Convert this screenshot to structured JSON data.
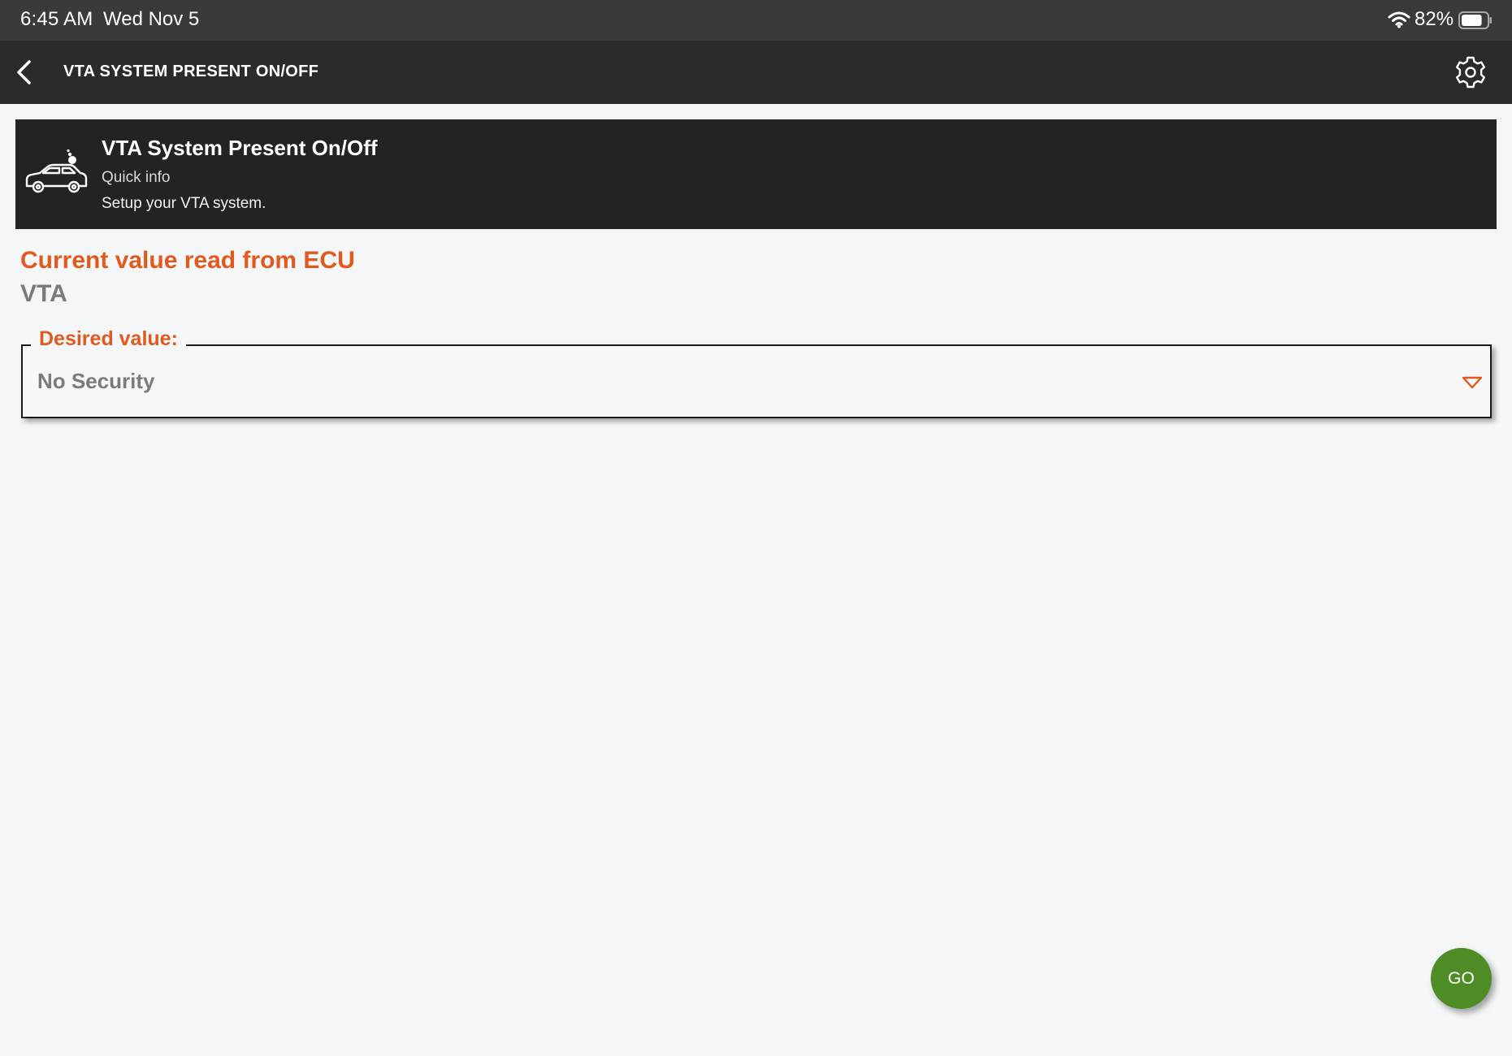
{
  "status_bar": {
    "time": "6:45 AM",
    "date": "Wed Nov 5",
    "battery_percent": "82%",
    "battery_level": 0.82,
    "wifi_icon": "wifi-icon",
    "battery_icon": "battery-icon"
  },
  "header": {
    "back_icon": "chevron-left-icon",
    "title": "VTA SYSTEM PRESENT ON/OFF",
    "settings_icon": "gear-icon"
  },
  "info_banner": {
    "icon": "car-alarm-icon",
    "title": "VTA System Present On/Off",
    "subtitle": "Quick info",
    "description": "Setup your VTA system."
  },
  "current_value": {
    "label": "Current value read from ECU",
    "value": "VTA"
  },
  "desired_value": {
    "label": "Desired value:",
    "selected": "No Security",
    "arrow_icon": "chevron-down-icon"
  },
  "go_button": {
    "label": "GO"
  },
  "colors": {
    "accent_orange": "#e05a1f",
    "go_green": "#4e8d26",
    "header_dark": "#2b2b2d",
    "banner_dark": "#232324",
    "status_bar": "#3a3a3c",
    "background": "#f5f6f8"
  }
}
